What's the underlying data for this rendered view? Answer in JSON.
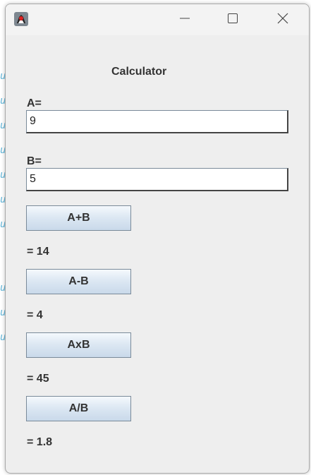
{
  "window": {
    "app_icon": "java-duke-icon",
    "controls": {
      "minimize": "minimize-icon",
      "maximize": "maximize-icon",
      "close": "close-icon"
    }
  },
  "calculator": {
    "title": "Calculator",
    "a_label": "A=",
    "a_value": "9",
    "b_label": "B=",
    "b_value": "5",
    "add_label": "A+B",
    "add_result": "= 14",
    "sub_label": "A-B",
    "sub_result": "= 4",
    "mul_label": "AxB",
    "mul_result": "= 45",
    "div_label": "A/B",
    "div_result": "= 1.8"
  },
  "colors": {
    "window_bg": "#eeeeee",
    "button_gradient_top": "#f5f9fd",
    "button_gradient_bottom": "#c9d9ea",
    "text": "#333333"
  }
}
